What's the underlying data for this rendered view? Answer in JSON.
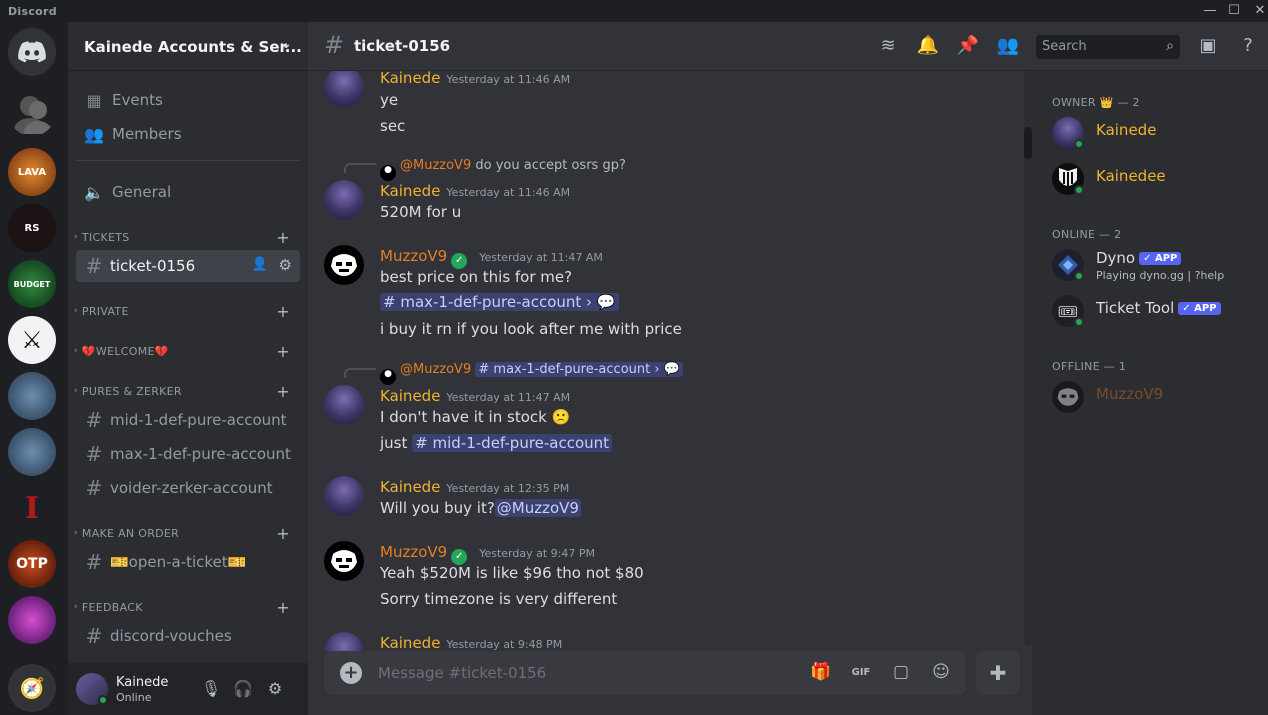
{
  "app": {
    "title": "Discord"
  },
  "window": {
    "minimize": "—",
    "maximize": "☐",
    "close": "✕"
  },
  "servers": [
    {
      "name": "Home",
      "label": ""
    },
    {
      "name": "Direct messages",
      "label": ""
    },
    {
      "name": "Lava Services",
      "label": "LAVA"
    },
    {
      "name": "RS Empire",
      "label": "RS"
    },
    {
      "name": "Budget Services",
      "label": "BUDGET"
    },
    {
      "name": "Swords",
      "label": ""
    },
    {
      "name": "Server 7",
      "label": ""
    },
    {
      "name": "Server 8",
      "label": ""
    },
    {
      "name": "Server 9",
      "label": ""
    },
    {
      "name": "OTP",
      "label": "OTP"
    },
    {
      "name": "Server 11",
      "label": ""
    }
  ],
  "guild": {
    "name": "Kainede Accounts & Ser..."
  },
  "sidebar": {
    "events": "Events",
    "members": "Members",
    "general": "General",
    "categories": [
      {
        "label": "TICKETS",
        "channels": [
          "ticket-0156"
        ]
      },
      {
        "label": "PRIVATE",
        "channels": []
      },
      {
        "label": "💔WELCOME💔",
        "channels": []
      },
      {
        "label": "PURES & ZERKER",
        "channels": [
          "mid-1-def-pure-account",
          "max-1-def-pure-account",
          "voider-zerker-account"
        ]
      },
      {
        "label": "MAKE AN ORDER",
        "channels": [
          "🎫open-a-ticket🎫"
        ]
      },
      {
        "label": "FEEDBACK",
        "channels": [
          "discord-vouches"
        ]
      }
    ]
  },
  "user": {
    "name": "Kainede",
    "status": "Online"
  },
  "channel": {
    "name": "ticket-0156"
  },
  "header": {
    "search_placeholder": "Search"
  },
  "messages": [
    {
      "author": "Kainede",
      "ts": "Yesterday at 11:46 AM",
      "lines": [
        "ye",
        "sec"
      ]
    },
    {
      "reply_to": "@MuzzoV9",
      "reply_text": "do you accept osrs gp?",
      "author": "Kainede",
      "ts": "Yesterday at 11:46 AM",
      "lines": [
        "520M for u"
      ]
    },
    {
      "author": "MuzzoV9",
      "ts": "Yesterday at 11:47 AM",
      "lines": [
        "best price on this for me?",
        "i buy it rn if you look after me with price"
      ],
      "channel_mention": "max-1-def-pure-account"
    },
    {
      "reply_to": "@MuzzoV9",
      "reply_text": "max-1-def-pure-account",
      "author": "Kainede",
      "ts": "Yesterday at 11:47 AM",
      "lines": [
        "I don't have it in stock",
        "just"
      ],
      "channel_mention": "mid-1-def-pure-account"
    },
    {
      "author": "Kainede",
      "ts": "Yesterday at 12:35 PM",
      "lines": [
        "Will you buy it?"
      ],
      "user_mention": "@MuzzoV9"
    },
    {
      "author": "MuzzoV9",
      "ts": "Yesterday at 9:47 PM",
      "lines": [
        "Yeah $520M is like $96 tho not $80",
        "Sorry timezone is very different"
      ]
    },
    {
      "author": "Kainede",
      "ts": "Yesterday at 9:48 PM",
      "lines": []
    }
  ],
  "composer": {
    "placeholder": "Message #ticket-0156"
  },
  "member_list": {
    "owner_label": "OWNER 👑 — 2",
    "online_label": "ONLINE — 2",
    "offline_label": "OFFLINE — 1",
    "owners": [
      "Kainede",
      "Kainedee"
    ],
    "online": [
      {
        "name": "Dyno",
        "badge": "✓ APP",
        "activity": "Playing dyno.gg | ?help"
      },
      {
        "name": "Ticket Tool",
        "badge": "✓ APP"
      }
    ],
    "offline": [
      "MuzzoV9"
    ]
  },
  "colors": {
    "owner": "#f0b232",
    "muzzo": "#e67e22",
    "mention_bg": "#3c4270",
    "online": "#23a55a"
  }
}
